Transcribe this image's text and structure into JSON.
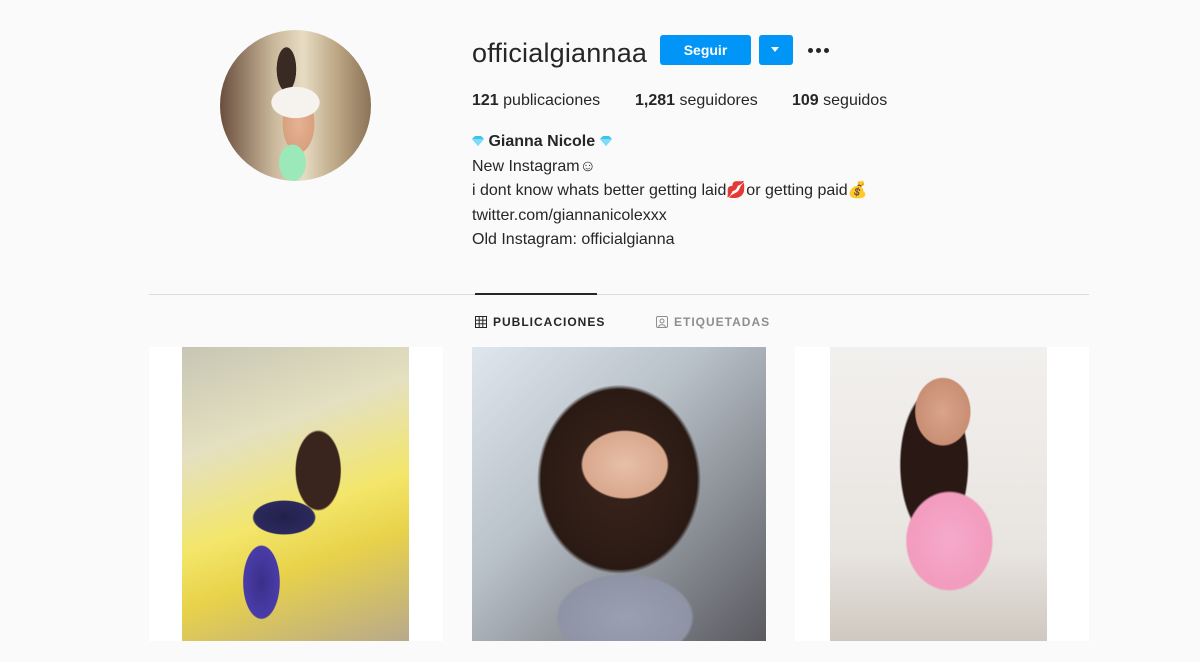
{
  "profile": {
    "username": "officialgiannaa",
    "follow_label": "Seguir"
  },
  "stats": {
    "posts_count": "121",
    "posts_label": "publicaciones",
    "followers_count": "1,281",
    "followers_label": "seguidores",
    "following_count": "109",
    "following_label": "seguidos"
  },
  "bio": {
    "full_name": "Gianna Nicole",
    "line1": "New Instagram☺",
    "line2_a": "i dont know whats better getting laid",
    "line2_emoji1": "💋",
    "line2_b": "or getting paid",
    "line2_emoji2": "💰",
    "link": "twitter.com/giannanicolexxx",
    "line4": "Old Instagram: officialgianna"
  },
  "tabs": {
    "posts": "PUBLICACIONES",
    "tagged": "ETIQUETADAS"
  },
  "icons": {
    "verified_gem": "diamond-icon",
    "more": "more-options-icon",
    "dropdown": "chevron-down-icon",
    "grid": "grid-icon",
    "tagged": "tag-icon"
  },
  "colors": {
    "accent": "#0095f6",
    "gem": "#3cc3f0"
  }
}
